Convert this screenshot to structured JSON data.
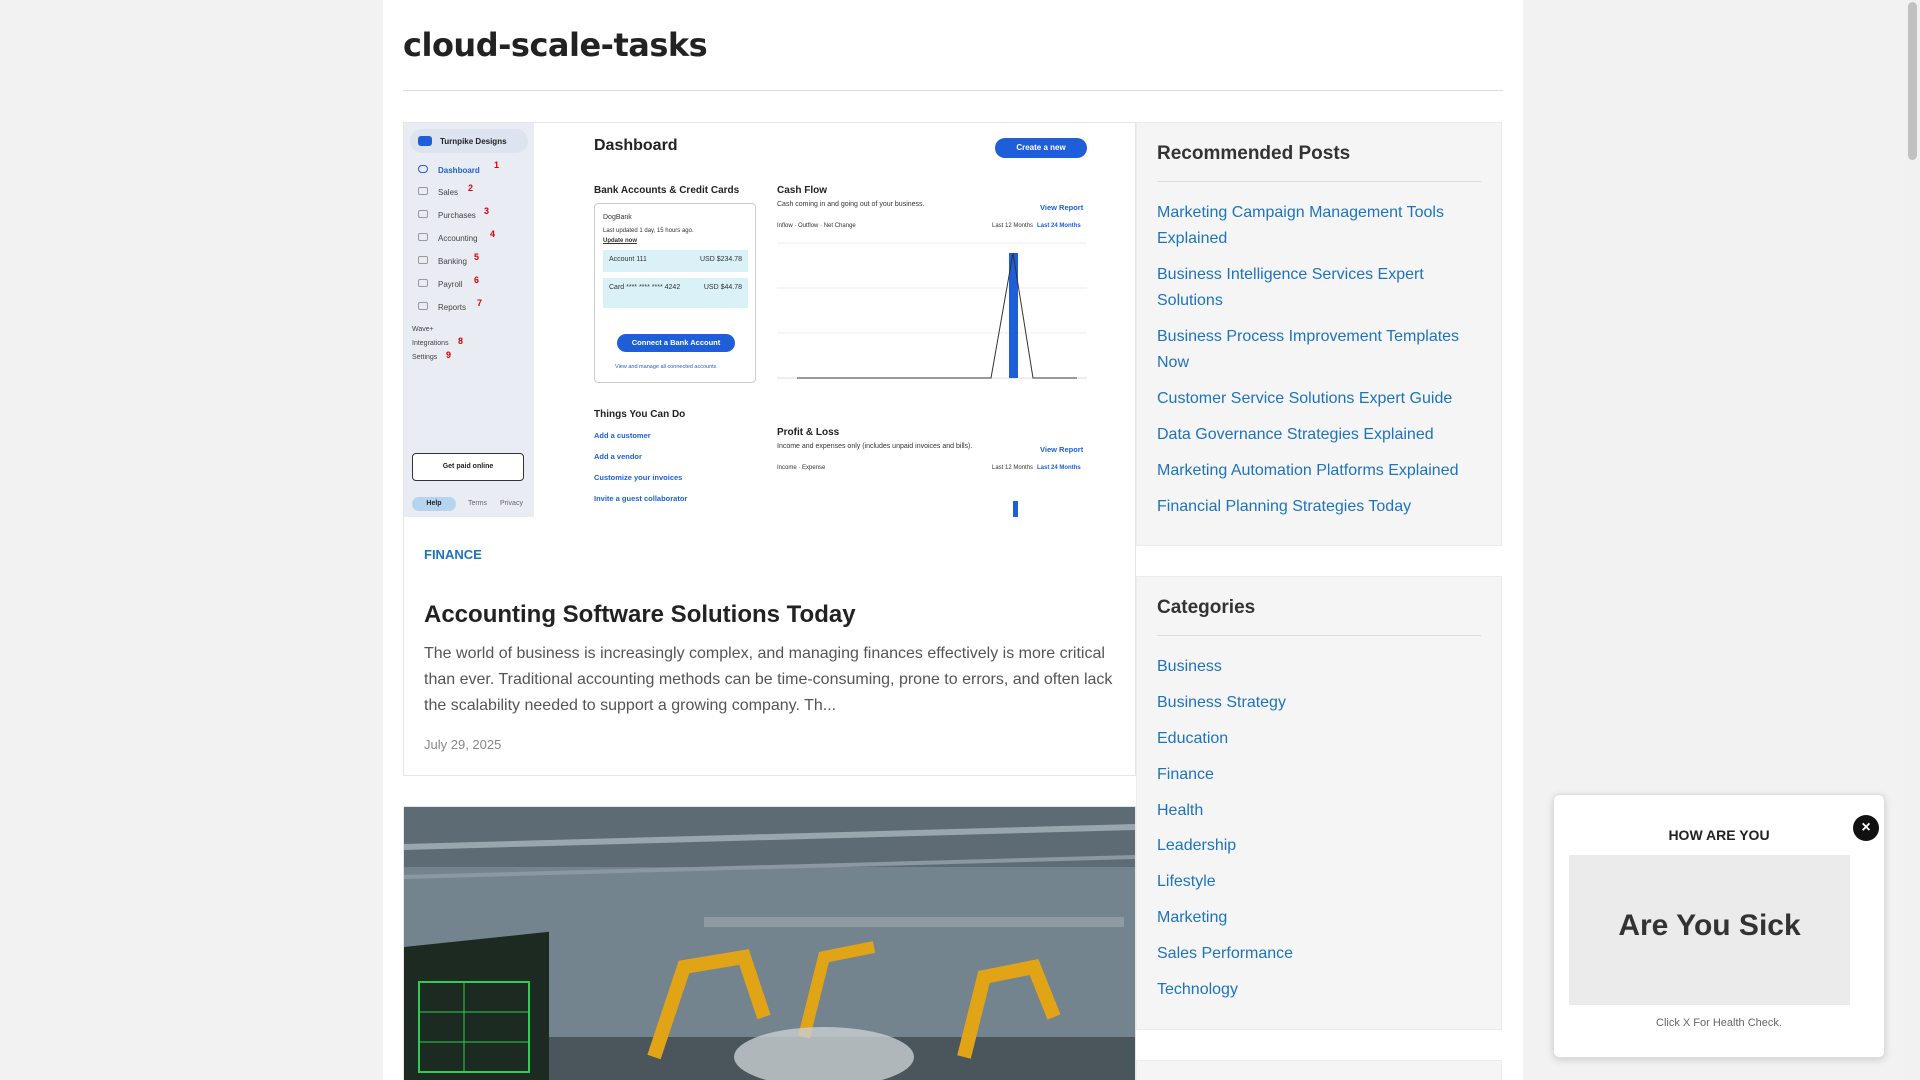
{
  "site": {
    "title": "cloud-scale-tasks"
  },
  "posts": [
    {
      "category": "FINANCE",
      "title": "Accounting Software Solutions Today",
      "excerpt": "The world of business is increasingly complex, and managing finances effectively is more critical than ever. Traditional accounting methods can be time-consuming, prone to errors, and often lack the scalability needed to support a growing company. Th...",
      "date": "July 29, 2025",
      "thumbnail": {
        "brand": "Turnpike Designs",
        "heading": "Dashboard",
        "create_button": "Create a new",
        "nav": [
          "Dashboard",
          "Sales",
          "Purchases",
          "Accounting",
          "Banking",
          "Payroll",
          "Reports"
        ],
        "nav_numbers": [
          "1",
          "2",
          "3",
          "4",
          "5",
          "6",
          "7"
        ],
        "extra_nav": [
          "Wave+",
          "Integrations",
          "Settings"
        ],
        "extra_numbers": [
          "8",
          "9"
        ],
        "bank_title": "Bank Accounts & Credit Cards",
        "bank_name": "DogBank",
        "bank_updated": "Last updated 1 day, 15 hours ago.",
        "bank_update_now": "Update now",
        "account_1": "Account 111",
        "account_1_val": "USD $234.78",
        "account_2": "Card **** **** **** 4242",
        "account_2_val": "USD $44.78",
        "connect_button": "Connect a Bank Account",
        "manage_link": "View and manage all connected accounts",
        "cash_flow_title": "Cash Flow",
        "cash_flow_sub": "Cash coming in and going out of your business.",
        "view_report": "View Report",
        "last_12": "Last 12 Months",
        "last_24": "Last 24 Months",
        "legend": [
          "Inflow",
          "Outflow",
          "Net Change"
        ],
        "things_title": "Things You Can Do",
        "things": [
          "Add a customer",
          "Add a vendor",
          "Customize your invoices",
          "Invite a guest collaborator"
        ],
        "pl_title": "Profit & Loss",
        "pl_sub": "Income and expenses only (includes unpaid invoices and bills).",
        "pl_legend": [
          "Income",
          "Expense"
        ],
        "paid_button": "Get paid online",
        "help": "Help",
        "terms": "Terms",
        "privacy": "Privacy"
      }
    }
  ],
  "recommended": {
    "title": "Recommended Posts",
    "items": [
      "Marketing Campaign Management Tools Explained",
      "Business Intelligence Services Expert Solutions",
      "Business Process Improvement Templates Now",
      "Customer Service Solutions Expert Guide",
      "Data Governance Strategies Explained",
      "Marketing Automation Platforms Explained",
      "Financial Planning Strategies Today"
    ]
  },
  "categories": {
    "title": "Categories",
    "items": [
      "Business",
      "Business Strategy",
      "Education",
      "Finance",
      "Health",
      "Leadership",
      "Lifestyle",
      "Marketing",
      "Sales Performance",
      "Technology"
    ]
  },
  "popup": {
    "title": "HOW ARE YOU",
    "image_text": "Are You Sick",
    "footer": "Click X For Health Check.",
    "close": "×"
  }
}
